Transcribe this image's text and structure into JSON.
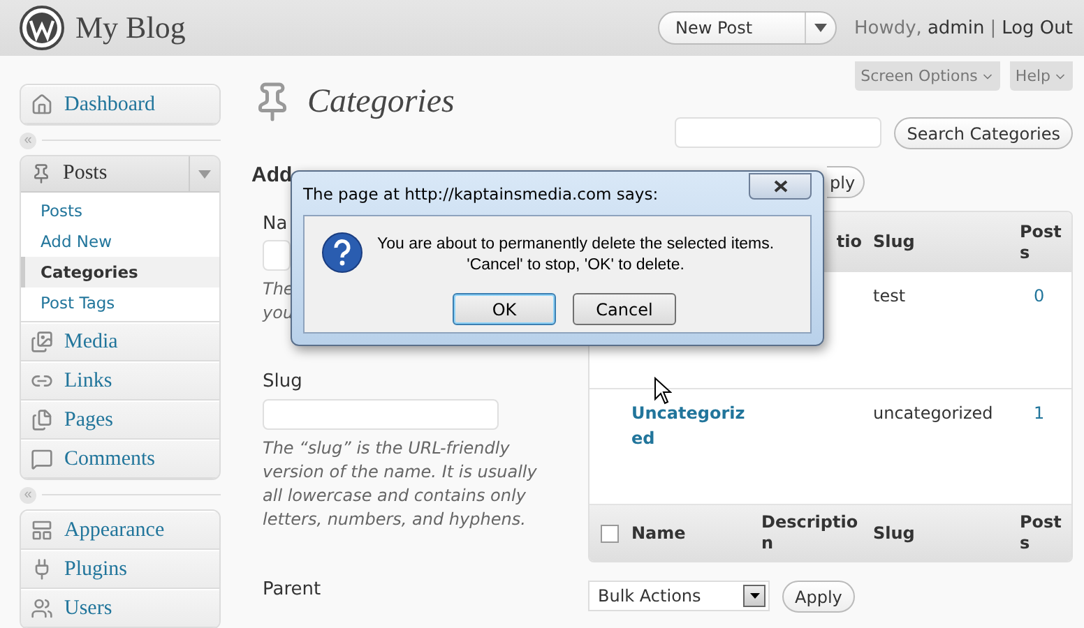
{
  "header": {
    "site_title": "My Blog",
    "new_post": "New Post",
    "greeting": "Howdy,",
    "user": "admin",
    "separator": "|",
    "logout": "Log Out"
  },
  "help_tabs": [
    {
      "label": "Screen Options"
    },
    {
      "label": "Help"
    }
  ],
  "sidebar": {
    "items": [
      {
        "kind": "item",
        "label": "Dashboard"
      },
      {
        "kind": "separator",
        "label": "«"
      },
      {
        "kind": "group",
        "label": "Posts",
        "expanded": true,
        "children": [
          {
            "label": "Posts",
            "selected": false
          },
          {
            "label": "Add New",
            "selected": false
          },
          {
            "label": "Categories",
            "selected": true
          },
          {
            "label": "Post Tags",
            "selected": false
          }
        ]
      },
      {
        "kind": "item",
        "label": "Media"
      },
      {
        "kind": "item",
        "label": "Links"
      },
      {
        "kind": "item",
        "label": "Pages"
      },
      {
        "kind": "item",
        "label": "Comments"
      },
      {
        "kind": "separator",
        "label": "«"
      },
      {
        "kind": "item",
        "label": "Appearance"
      },
      {
        "kind": "item",
        "label": "Plugins"
      },
      {
        "kind": "item",
        "label": "Users"
      }
    ]
  },
  "page": {
    "title": "Categories",
    "search_button": "Search Categories"
  },
  "form": {
    "heading": "Add",
    "name_label": "Na",
    "name_hint_lines": [
      "The",
      "you"
    ],
    "slug_label": "Slug",
    "slug_hint": "The “slug” is the URL-friendly version of the name. It is usually all lowercase and contains only letters, numbers, and hyphens.",
    "parent_label": "Parent"
  },
  "table": {
    "top_apply": "ply",
    "top_header": {
      "description_part": "tio",
      "slug": "Slug",
      "posts": "Posts"
    },
    "rows": [
      {
        "name": "",
        "slug": "test",
        "posts": "0"
      },
      {
        "name": "Uncategorized",
        "slug": "uncategorized",
        "posts": "1"
      }
    ],
    "footer": {
      "checked": false,
      "columns": [
        "Name",
        "Description",
        "Slug",
        "Posts"
      ]
    },
    "bulk_select": "Bulk Actions",
    "apply": "Apply"
  },
  "dialog": {
    "title": "The page at http://kaptainsmedia.com says:",
    "message": [
      "You are about to permanently delete the selected items.",
      "'Cancel' to stop, 'OK' to delete."
    ],
    "buttons": [
      {
        "label": "OK",
        "default": true
      },
      {
        "label": "Cancel",
        "default": false
      }
    ]
  }
}
